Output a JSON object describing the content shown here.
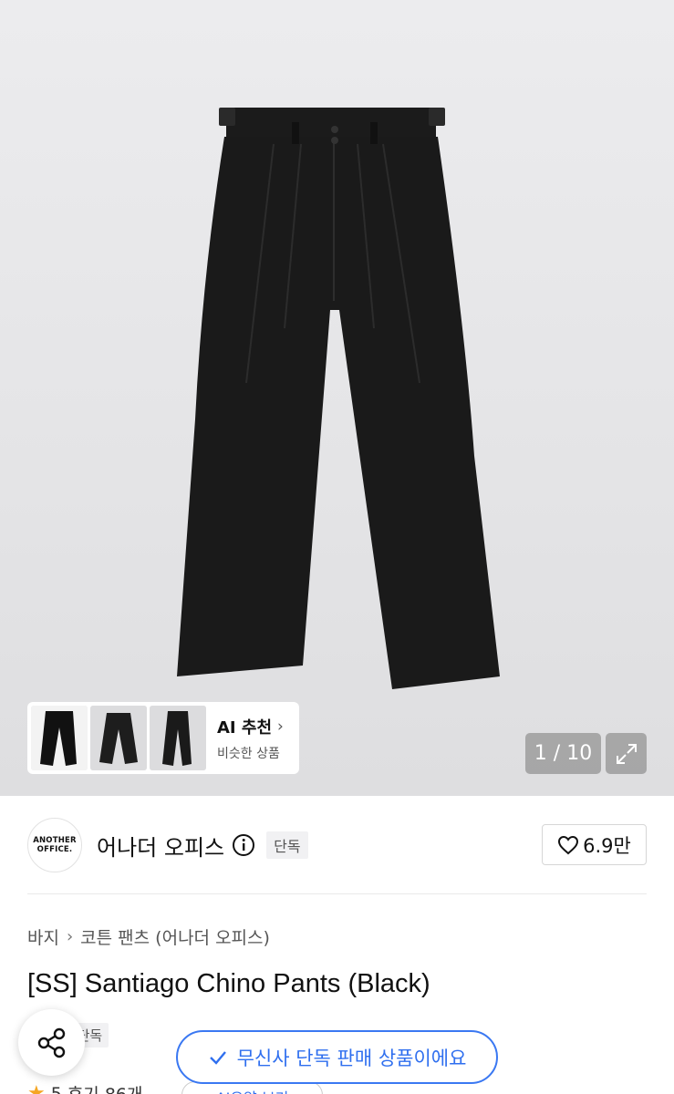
{
  "gallery": {
    "counter": "1 / 10",
    "expand_icon": "expand-icon",
    "ai_recommend": {
      "title": "AI 추천",
      "subtitle": "비슷한 상품"
    }
  },
  "brand": {
    "logo_line1": "ANOTHER",
    "logo_line2": "OFFICE.",
    "name": "어나더 오피스",
    "exclusive_label": "단독",
    "likes": "6.9만"
  },
  "breadcrumb": {
    "category": "바지",
    "subcategory": "코튼 팬츠 (어나더 오피스)"
  },
  "product": {
    "title": "[SS] Santiago Chino Pants (Black)",
    "tag": "단독"
  },
  "notice": {
    "text": "무신사 단독 판매 상품이에요"
  },
  "rating": {
    "score": "5",
    "reviews": "후기 86개"
  },
  "ai_summary": {
    "label": "AI요약 보기"
  },
  "colors": {
    "accent_blue": "#2f6fef",
    "star": "#f5a623"
  }
}
